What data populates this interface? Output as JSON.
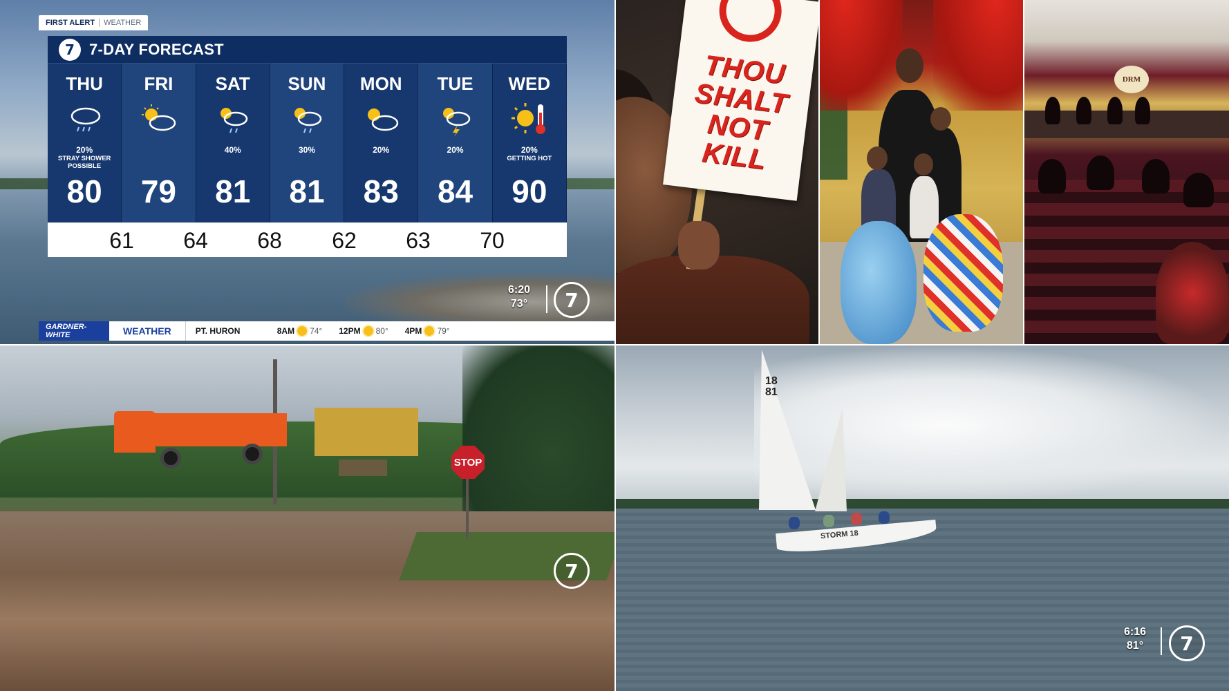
{
  "weather": {
    "tag": {
      "left": "FIRST ALERT",
      "right": "WEATHER"
    },
    "title": "7-DAY FORECAST",
    "station_logo": "7",
    "days": [
      {
        "name": "THU",
        "icon": "rain-cloud-icon",
        "pop": "20%",
        "note": "STRAY SHOWER POSSIBLE",
        "high": "80"
      },
      {
        "name": "FRI",
        "icon": "partly-cloudy-icon",
        "pop": "",
        "note": "",
        "high": "79"
      },
      {
        "name": "SAT",
        "icon": "sun-rain-cloud-icon",
        "pop": "40%",
        "note": "",
        "high": "81"
      },
      {
        "name": "SUN",
        "icon": "sun-rain-cloud-icon",
        "pop": "30%",
        "note": "",
        "high": "81"
      },
      {
        "name": "MON",
        "icon": "partly-cloudy-icon",
        "pop": "20%",
        "note": "",
        "high": "83"
      },
      {
        "name": "TUE",
        "icon": "sun-storm-cloud-icon",
        "pop": "20%",
        "note": "",
        "high": "84"
      },
      {
        "name": "WED",
        "icon": "sun-thermometer-icon",
        "pop": "20%",
        "note": "GETTING HOT",
        "high": "90"
      }
    ],
    "lows": [
      "61",
      "64",
      "68",
      "62",
      "63",
      "70"
    ],
    "time": "6:20",
    "temp": "73°",
    "ticker": {
      "sponsor": "GARDNER-WHITE",
      "label": "WEATHER",
      "location": "PT. HURON",
      "slots": [
        {
          "time": "8AM",
          "temp": "74°"
        },
        {
          "time": "12PM",
          "temp": "80°"
        },
        {
          "time": "4PM",
          "temp": "79°"
        }
      ]
    }
  },
  "protest": {
    "sign_lines": [
      "THOU",
      "SHALT",
      "NOT",
      "KILL"
    ]
  },
  "church": {
    "crest": "DRM"
  },
  "flood": {
    "stop_sign": "STOP"
  },
  "sail": {
    "sail_number": [
      "18",
      "81"
    ],
    "hull_name": "STORM 18",
    "time": "6:16",
    "temp": "81°"
  },
  "colors": {
    "forecast_bg": "#17386e",
    "forecast_header": "#0e2e62",
    "sponsor": "#1a3f9c",
    "stop": "#c8202a",
    "sign_text": "#d8241c"
  }
}
